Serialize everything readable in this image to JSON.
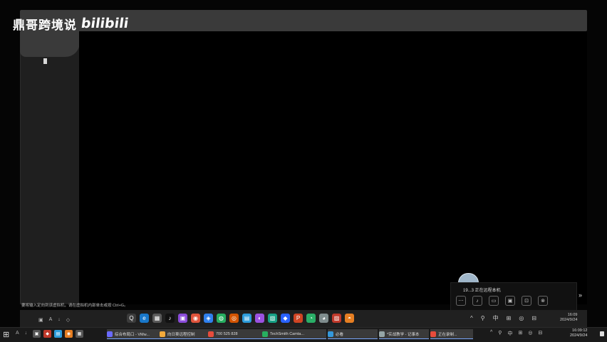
{
  "watermark": {
    "channel": "鼎哥跨境说",
    "brand": "bilibili"
  },
  "status_hint": "要将输入定向到该虚拟机，请在虚拟机内部单击或按 Ctrl+G。",
  "inner_taskbar": {
    "left_tools": [
      "▣",
      "A",
      "↓",
      "◇"
    ],
    "apps": [
      {
        "name": "search",
        "glyph": "Q",
        "color": "#3b3b3b"
      },
      {
        "name": "edge",
        "glyph": "e",
        "color": "#1877c9"
      },
      {
        "name": "store",
        "glyph": "▦",
        "color": "#5a5a5a"
      },
      {
        "name": "tiktok",
        "glyph": "♪",
        "color": "#111111"
      },
      {
        "name": "app5",
        "glyph": "▣",
        "color": "#8a4bd9"
      },
      {
        "name": "app6",
        "glyph": "◉",
        "color": "#e0543c"
      },
      {
        "name": "app7",
        "glyph": "◈",
        "color": "#2f80ed"
      },
      {
        "name": "app8",
        "glyph": "◍",
        "color": "#27ae60"
      },
      {
        "name": "app9",
        "glyph": "◎",
        "color": "#d35400"
      },
      {
        "name": "app10",
        "glyph": "▤",
        "color": "#2d9cdb"
      },
      {
        "name": "app11",
        "glyph": "◐",
        "color": "#9b51e0"
      },
      {
        "name": "app12",
        "glyph": "▧",
        "color": "#16a085"
      },
      {
        "name": "app13",
        "glyph": "◆",
        "color": "#2962ff"
      },
      {
        "name": "app14",
        "glyph": "P",
        "color": "#d04423"
      },
      {
        "name": "wechat",
        "glyph": "◔",
        "color": "#2aae67"
      },
      {
        "name": "app16",
        "glyph": "◕",
        "color": "#7f8c8d"
      },
      {
        "name": "app17",
        "glyph": "▨",
        "color": "#c0392b"
      },
      {
        "name": "app18",
        "glyph": "◓",
        "color": "#e67e22"
      }
    ],
    "tray": [
      "^",
      "⚲",
      "中",
      "⊞",
      "◎",
      "⊟"
    ],
    "clock": {
      "time": "16:09",
      "date": "2024/9/24"
    }
  },
  "notification": {
    "title": "19...3 正在远程本机",
    "buttons": [
      "⋯",
      "♪",
      "▭",
      "▣",
      "⊡",
      "⊗"
    ],
    "expand": "»"
  },
  "host_taskbar": {
    "start": "⊞",
    "tools": [
      "A",
      "↓",
      "◇"
    ],
    "pinned": [
      {
        "glyph": "▣",
        "color": "#555"
      },
      {
        "glyph": "◆",
        "color": "#c0392b"
      },
      {
        "glyph": "▤",
        "color": "#2d9cdb"
      },
      {
        "glyph": "◉",
        "color": "#e67e22"
      },
      {
        "glyph": "▦",
        "color": "#555"
      }
    ],
    "tasks": [
      {
        "label": "综合布局口 - VMw...",
        "color": "#6a6aff"
      },
      {
        "label": "向日葵远程控制",
        "color": "#f2a93b"
      },
      {
        "label": "700 525 828",
        "color": "#e74c3c"
      },
      {
        "label": "TechSmith Camta...",
        "color": "#27ae60"
      },
      {
        "label": "必看",
        "color": "#3498db"
      },
      {
        "label": "*实战教学 - 记事本",
        "color": "#95a5a6"
      },
      {
        "label": "正在录制...",
        "color": "#e74c3c"
      }
    ],
    "tray": [
      "^",
      "⚲",
      "中",
      "⊞",
      "◎",
      "⊟"
    ],
    "clock": {
      "time": "16:09:12",
      "date": "2024/9/24"
    }
  }
}
